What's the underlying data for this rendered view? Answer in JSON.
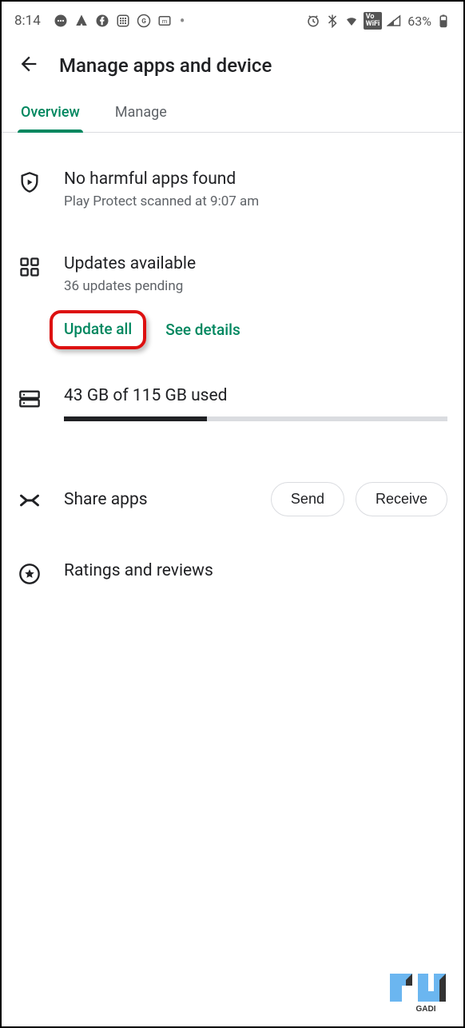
{
  "status": {
    "time": "8:14",
    "battery": "63%"
  },
  "header": {
    "title": "Manage apps and device"
  },
  "tabs": {
    "overview": "Overview",
    "manage": "Manage"
  },
  "protect": {
    "title": "No harmful apps found",
    "subtitle": "Play Protect scanned at 9:07 am"
  },
  "updates": {
    "title": "Updates available",
    "subtitle": "36 updates pending",
    "update_all": "Update all",
    "see_details": "See details"
  },
  "storage": {
    "label": "43 GB of 115 GB used",
    "used": 43,
    "total": 115
  },
  "share": {
    "title": "Share apps",
    "send": "Send",
    "receive": "Receive"
  },
  "ratings": {
    "title": "Ratings and reviews"
  }
}
